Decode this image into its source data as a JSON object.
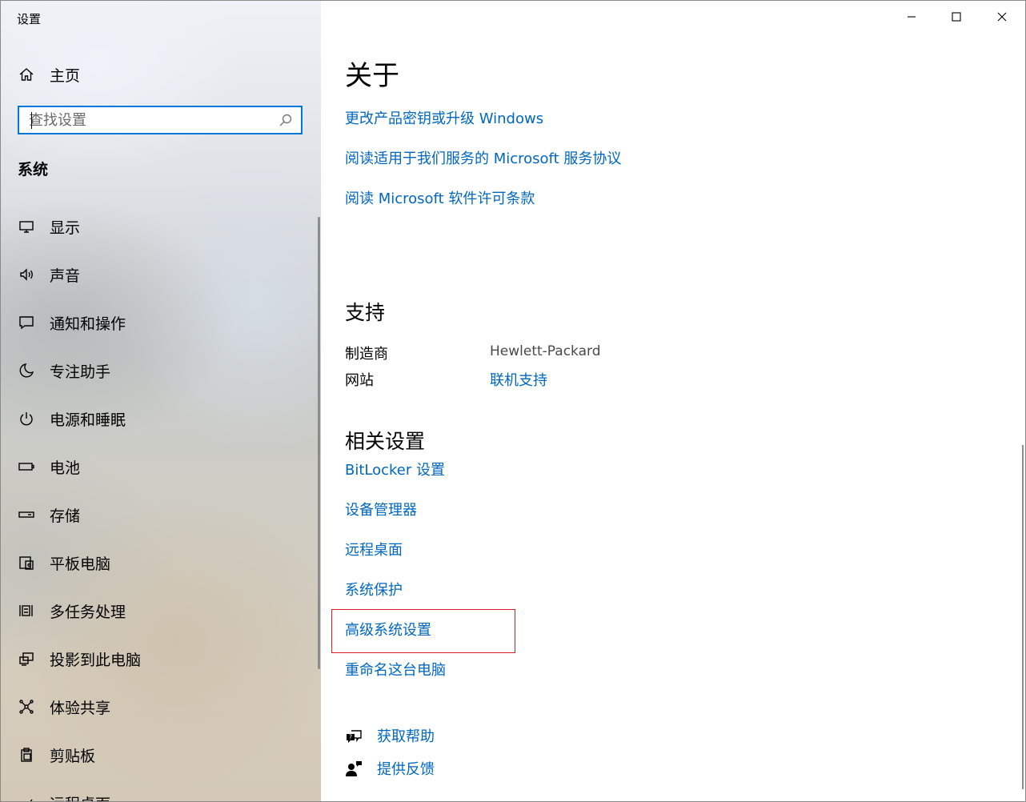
{
  "window": {
    "title": "设置"
  },
  "sidebar": {
    "home_label": "主页",
    "search_placeholder": "查找设置",
    "section_title": "系统",
    "items": [
      {
        "label": "显示",
        "icon": "monitor-icon"
      },
      {
        "label": "声音",
        "icon": "speaker-icon"
      },
      {
        "label": "通知和操作",
        "icon": "notification-icon"
      },
      {
        "label": "专注助手",
        "icon": "moon-icon"
      },
      {
        "label": "电源和睡眠",
        "icon": "power-icon"
      },
      {
        "label": "电池",
        "icon": "battery-icon"
      },
      {
        "label": "存储",
        "icon": "storage-icon"
      },
      {
        "label": "平板电脑",
        "icon": "tablet-icon"
      },
      {
        "label": "多任务处理",
        "icon": "multitask-icon"
      },
      {
        "label": "投影到此电脑",
        "icon": "project-icon"
      },
      {
        "label": "体验共享",
        "icon": "share-icon"
      },
      {
        "label": "剪贴板",
        "icon": "clipboard-icon"
      },
      {
        "label": "远程桌面",
        "icon": "remote-desktop-icon"
      }
    ]
  },
  "main": {
    "about_title": "关于",
    "about_links": [
      "更改产品密钥或升级 Windows",
      "阅读适用于我们服务的 Microsoft 服务协议",
      "阅读 Microsoft 软件许可条款"
    ],
    "support_title": "支持",
    "support": {
      "manufacturer_label": "制造商",
      "manufacturer_value": "Hewlett-Packard",
      "website_label": "网站",
      "website_link": "联机支持"
    },
    "related_title": "相关设置",
    "related_links": [
      "BitLocker 设置",
      "设备管理器",
      "远程桌面",
      "系统保护",
      "高级系统设置",
      "重命名这台电脑"
    ],
    "help": {
      "get_help": "获取帮助",
      "feedback": "提供反馈"
    }
  },
  "colors": {
    "link": "#0067c0",
    "accent": "#0078d7",
    "highlight": "#e02020"
  }
}
